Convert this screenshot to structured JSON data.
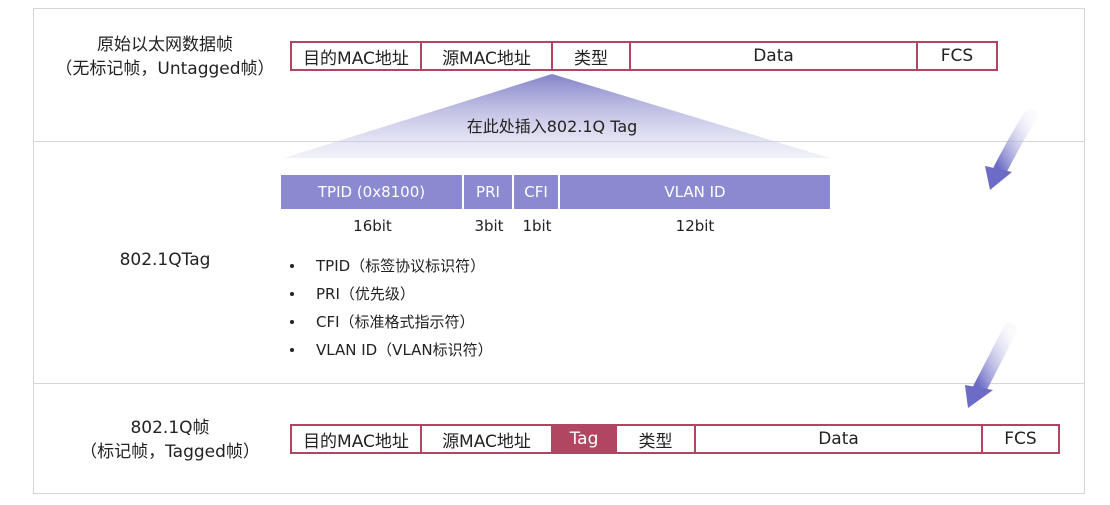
{
  "original_frame": {
    "label_line1": "原始以太网数据帧",
    "label_line2": "（无标记帧，Untagged帧）",
    "fields": [
      "目的MAC地址",
      "源MAC地址",
      "类型",
      "Data",
      "FCS"
    ]
  },
  "insert_text": "在此处插入802.1Q Tag",
  "tag_section": {
    "label": "802.1QTag",
    "fields": [
      "TPID (0x8100)",
      "PRI",
      "CFI",
      "VLAN ID"
    ],
    "bits": [
      "16bit",
      "3bit",
      "1bit",
      "12bit"
    ],
    "bullets": [
      "TPID（标签协议标识符）",
      "PRI（优先级）",
      "CFI（标准格式指示符）",
      "VLAN ID（VLAN标识符）"
    ]
  },
  "tagged_frame": {
    "label_line1": "802.1Q帧",
    "label_line2": "（标记帧，Tagged帧）",
    "fields": [
      "目的MAC地址",
      "源MAC地址",
      "Tag",
      "类型",
      "Data",
      "FCS"
    ]
  },
  "colors": {
    "frame_border": "#b0465f",
    "tag_fill": "#8b8ad0",
    "arrow": "#6c6cc6",
    "divider": "#d6d6d6"
  }
}
